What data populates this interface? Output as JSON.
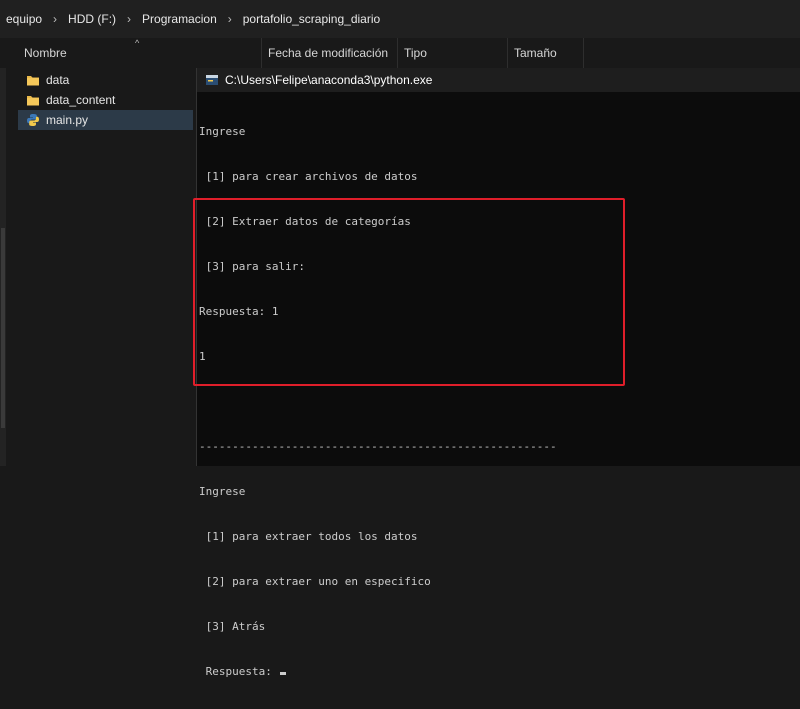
{
  "breadcrumb": [
    "equipo",
    "HDD (F:)",
    "Programacion",
    "portafolio_scraping_diario"
  ],
  "columns": {
    "name": "Nombre",
    "modified": "Fecha de modificación",
    "type": "Tipo",
    "size": "Tamaño"
  },
  "files": [
    {
      "name": "data",
      "icon": "folder-icon"
    },
    {
      "name": "data_content",
      "icon": "folder-icon"
    },
    {
      "name": "main.py",
      "icon": "python-file-icon",
      "selected": true
    }
  ],
  "console": {
    "title": "C:\\Users\\Felipe\\anaconda3\\python.exe",
    "lines": [
      "Ingrese",
      " [1] para crear archivos de datos",
      " [2] Extraer datos de categorías",
      " [3] para salir:",
      "Respuesta: 1",
      "1",
      "",
      "------------------------------------------------------",
      "Ingrese",
      " [1] para extraer todos los datos",
      " [2] para extraer uno en especifico",
      " [3] Atrás",
      " Respuesta: "
    ]
  },
  "colors": {
    "highlight_border": "#e01e2a",
    "folder": "#e8b84a",
    "console_bg": "#0c0c0c",
    "console_text": "#cccccc"
  }
}
